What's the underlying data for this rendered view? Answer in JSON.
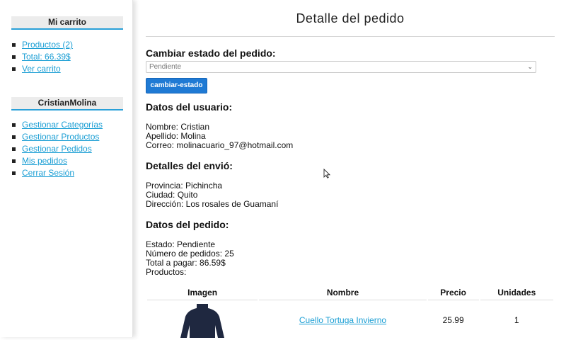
{
  "sidebar": {
    "cart": {
      "title": "Mi carrito",
      "items": [
        "Productos (2)",
        "Total: 66.39$",
        "Ver carrito"
      ]
    },
    "user": {
      "title": "CristianMolina",
      "items": [
        "Gestionar Categorías",
        "Gestionar Productos",
        "Gestionar Pedidos",
        "Mis pedidos",
        "Cerrar Sesión"
      ]
    }
  },
  "main": {
    "title": "Detalle del pedido",
    "change_status": {
      "heading": "Cambiar estado del pedido:",
      "selected": "Pendiente",
      "button": "cambiar-estado"
    },
    "user_data": {
      "heading": "Datos del usuario:",
      "lines": [
        "Nombre: Cristian",
        "Apellido: Molina",
        "Correo: molinacuario_97@hotmail.com"
      ]
    },
    "shipping": {
      "heading": "Detalles del envió:",
      "lines": [
        "Provincia: Pichincha",
        "Ciudad: Quito",
        "Dirección: Los rosales de Guamaní"
      ]
    },
    "order": {
      "heading": "Datos del pedido:",
      "lines": [
        "Estado: Pendiente",
        "Número de pedidos: 25",
        "Total a pagar: 86.59$",
        "Productos:"
      ]
    },
    "table": {
      "headers": [
        "Imagen",
        "Nombre",
        "Precio",
        "Unidades"
      ],
      "rows": [
        {
          "name": "Cuello Tortuga Invierno",
          "price": "25.99",
          "units": "1"
        }
      ]
    }
  },
  "colors": {
    "accent": "#2aa0d8",
    "link": "#1a9ed4",
    "button": "#1f7ad4"
  }
}
